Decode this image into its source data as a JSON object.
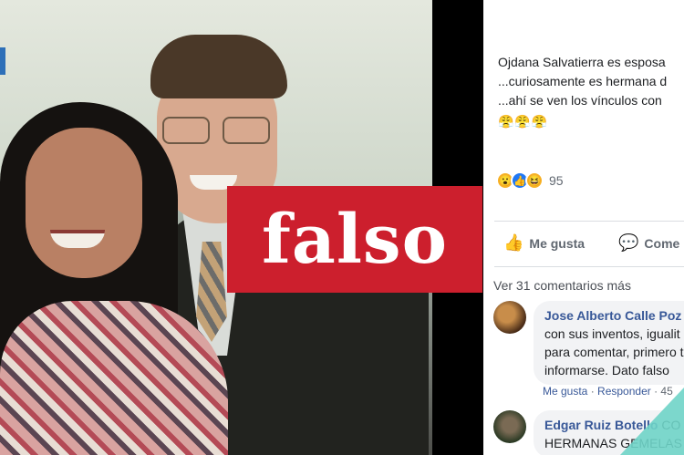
{
  "stamp": {
    "label": "falso"
  },
  "post": {
    "lines": [
      "Ojdana Salvatierra es esposa",
      "...curiosamente es hermana d",
      "...ahí se ven los vínculos con"
    ],
    "emojis": "😤😤😤"
  },
  "reactions": {
    "icons": [
      "wow-reaction-icon",
      "like-reaction-icon",
      "haha-reaction-icon"
    ],
    "count": "95"
  },
  "actions": {
    "like_label": "Me gusta",
    "comment_label": "Come"
  },
  "comments_section": {
    "more_label": "Ver 31 comentarios más",
    "comments": [
      {
        "author": "Jose Alberto Calle Poz",
        "lines": [
          "con sus inventos, igualit",
          "para comentar, primero t",
          "informarse. Dato falso"
        ],
        "meta_like": "Me gusta",
        "meta_sep": " · ",
        "meta_reply": "Responder",
        "meta_time": " · 45"
      },
      {
        "author": "Edgar Ruiz Botello",
        "author_suffix": " CO",
        "lines": [
          "HERMANAS GEMELAS"
        ]
      }
    ]
  },
  "colors": {
    "stamp_red": "#cc1f2d",
    "fb_link": "#385898",
    "accent_teal": "#6fd4c8"
  }
}
